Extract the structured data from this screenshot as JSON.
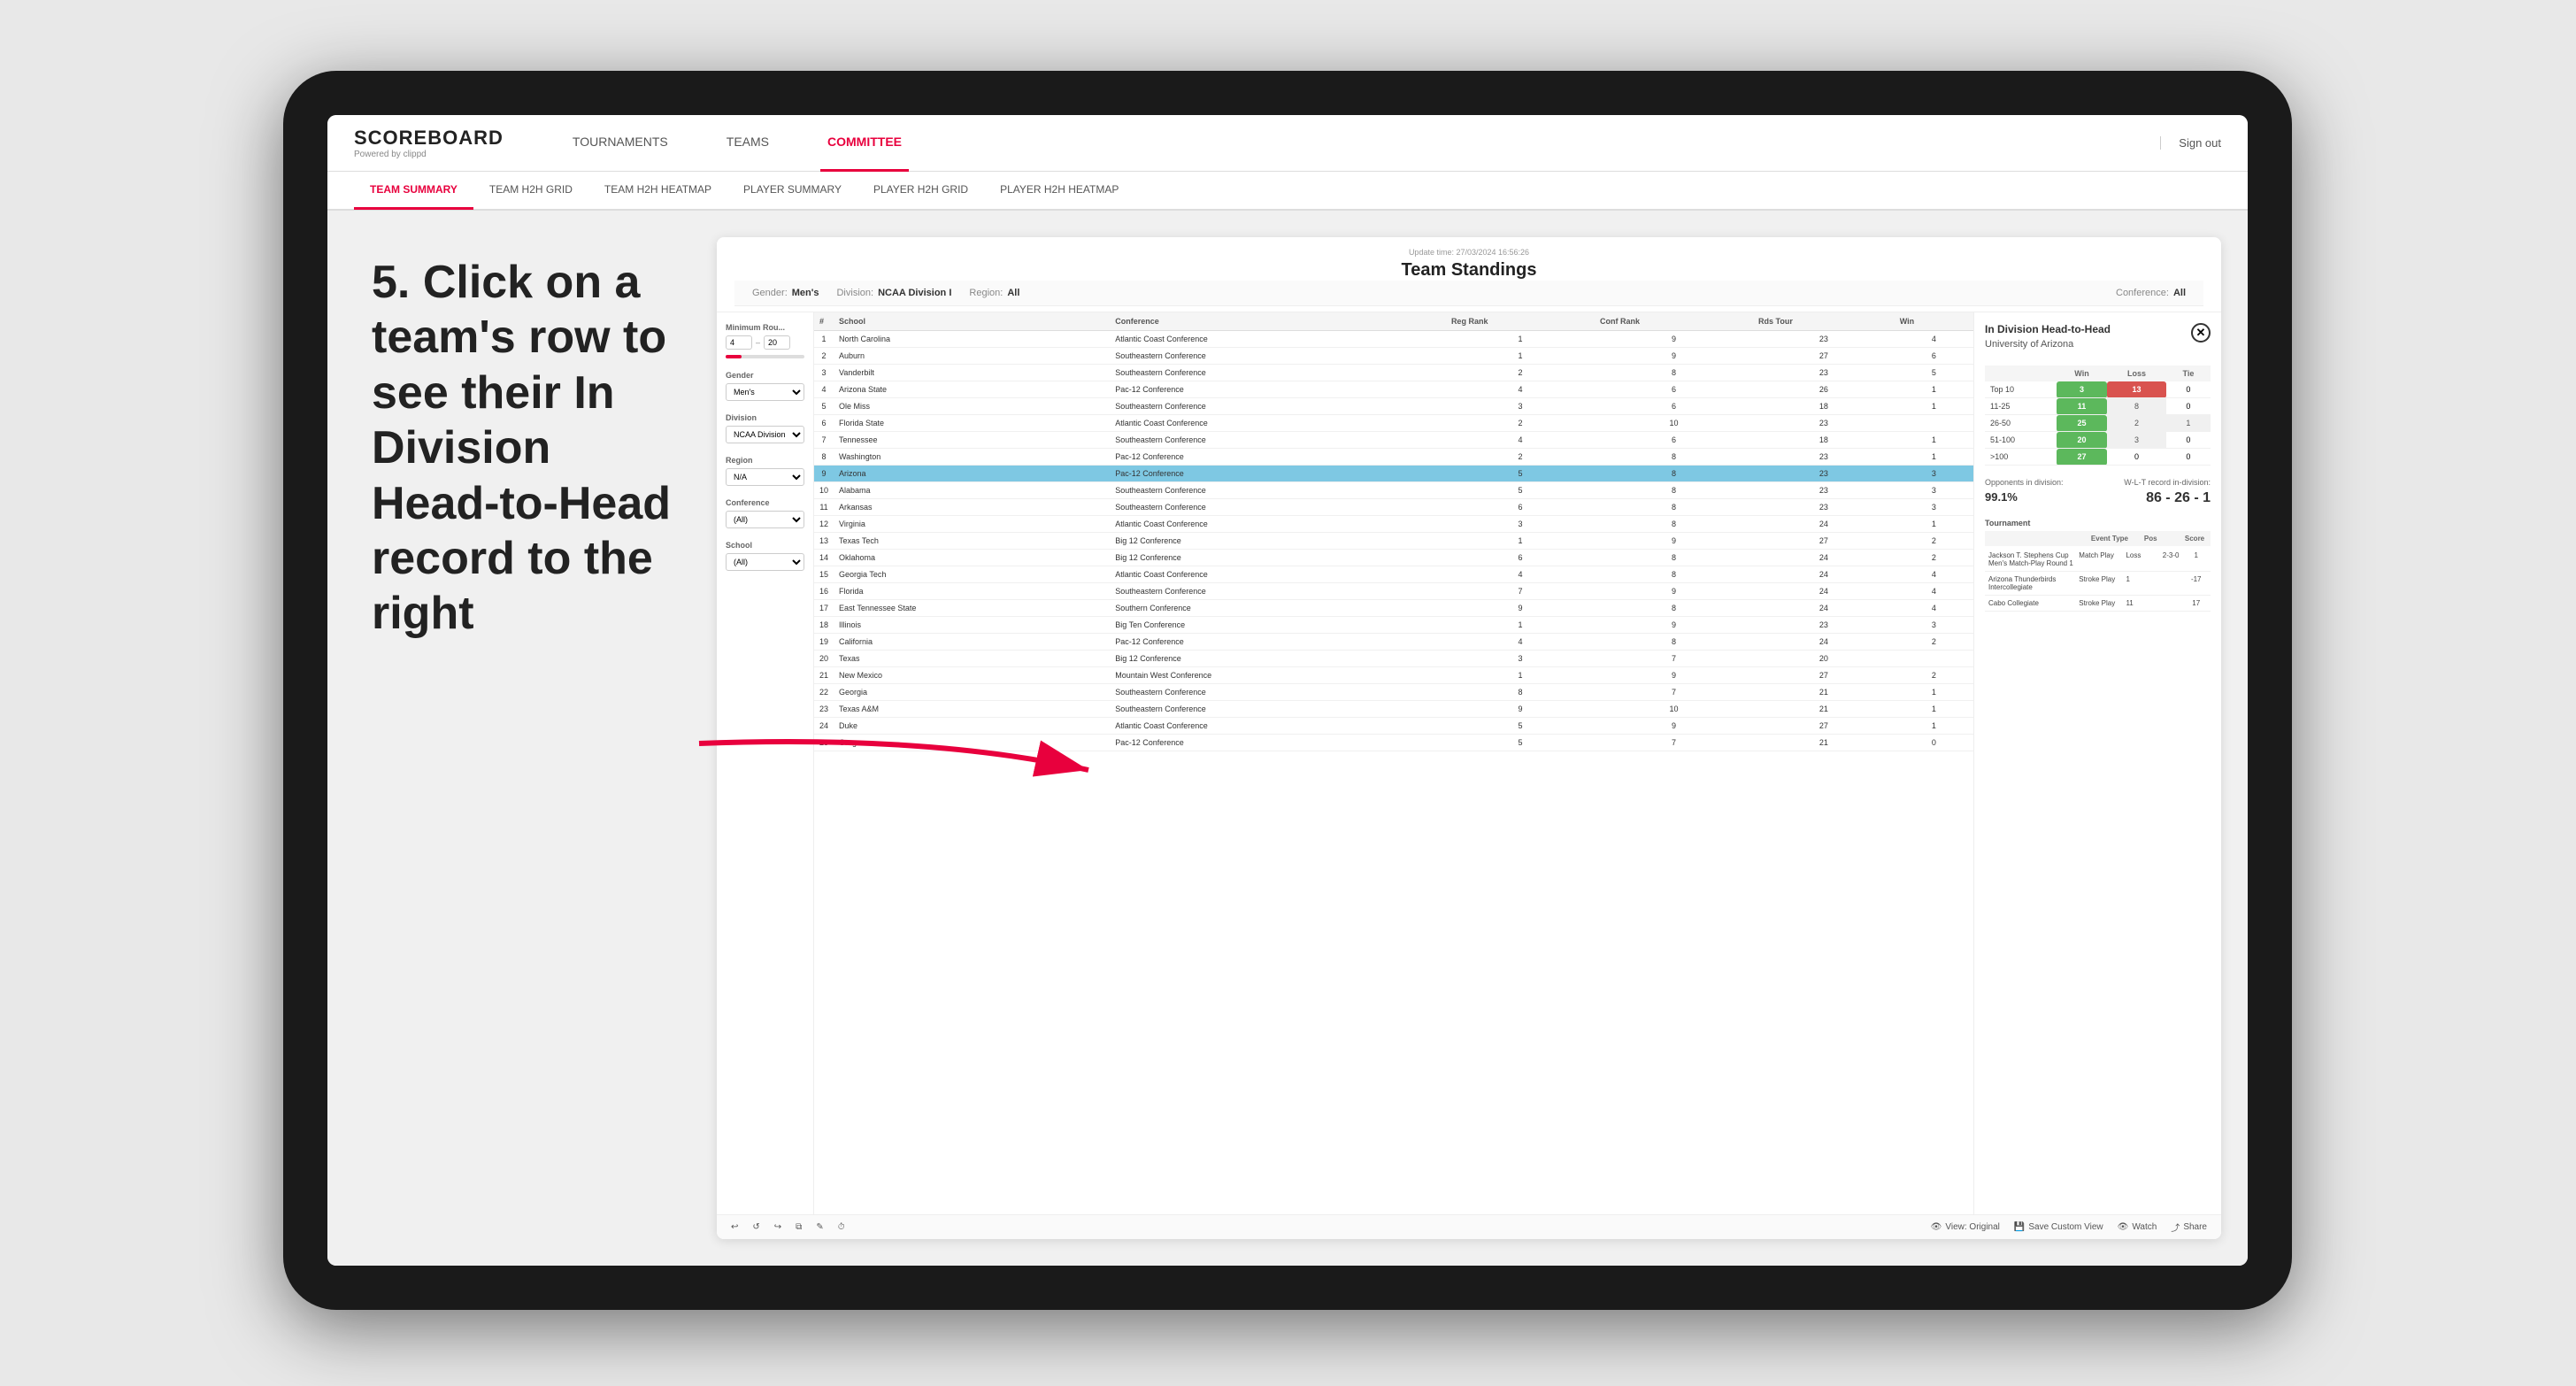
{
  "page": {
    "background": "#e8e8e8"
  },
  "nav": {
    "logo": "SCOREBOARD",
    "logo_sub": "Powered by clippd",
    "items": [
      {
        "label": "TOURNAMENTS",
        "active": false
      },
      {
        "label": "TEAMS",
        "active": false
      },
      {
        "label": "COMMITTEE",
        "active": true
      }
    ],
    "sign_out": "Sign out"
  },
  "sub_nav": {
    "items": [
      {
        "label": "TEAM SUMMARY",
        "active": true
      },
      {
        "label": "TEAM H2H GRID",
        "active": false
      },
      {
        "label": "TEAM H2H HEATMAP",
        "active": false
      },
      {
        "label": "PLAYER SUMMARY",
        "active": false
      },
      {
        "label": "PLAYER H2H GRID",
        "active": false
      },
      {
        "label": "PLAYER H2H HEATMAP",
        "active": false
      }
    ]
  },
  "instruction": {
    "text": "5. Click on a team's row to see their In Division Head-to-Head record to the right"
  },
  "app": {
    "update_time_label": "Update time:",
    "update_time": "27/03/2024 16:56:26",
    "title": "Team Standings",
    "filters": {
      "gender_label": "Gender:",
      "gender_value": "Men's",
      "division_label": "Division:",
      "division_value": "NCAA Division I",
      "region_label": "Region:",
      "region_value": "All",
      "conference_label": "Conference:",
      "conference_value": "All"
    },
    "sidebar": {
      "min_rounds_label": "Minimum Rou...",
      "min_val": "4",
      "max_val": "20",
      "gender_label": "Gender",
      "gender_options": [
        "Men's"
      ],
      "division_label": "Division",
      "division_options": [
        "NCAA Division I"
      ],
      "region_label": "Region",
      "region_options": [
        "N/A"
      ],
      "conference_label": "Conference",
      "conference_options": [
        "(All)"
      ],
      "school_label": "School",
      "school_options": [
        "(All)"
      ]
    },
    "table": {
      "headers": [
        "#",
        "School",
        "Conference",
        "Reg Rank",
        "Conf Rank",
        "Rds Tour",
        "Win"
      ],
      "rows": [
        {
          "rank": "1",
          "school": "North Carolina",
          "conference": "Atlantic Coast Conference",
          "reg_rank": "1",
          "conf_rank": "9",
          "rds": "23",
          "win": "4"
        },
        {
          "rank": "2",
          "school": "Auburn",
          "conference": "Southeastern Conference",
          "reg_rank": "1",
          "conf_rank": "9",
          "rds": "27",
          "win": "6"
        },
        {
          "rank": "3",
          "school": "Vanderbilt",
          "conference": "Southeastern Conference",
          "reg_rank": "2",
          "conf_rank": "8",
          "rds": "23",
          "win": "5"
        },
        {
          "rank": "4",
          "school": "Arizona State",
          "conference": "Pac-12 Conference",
          "reg_rank": "4",
          "conf_rank": "6",
          "rds": "26",
          "win": "1"
        },
        {
          "rank": "5",
          "school": "Ole Miss",
          "conference": "Southeastern Conference",
          "reg_rank": "3",
          "conf_rank": "6",
          "rds": "18",
          "win": "1"
        },
        {
          "rank": "6",
          "school": "Florida State",
          "conference": "Atlantic Coast Conference",
          "reg_rank": "2",
          "conf_rank": "10",
          "rds": "23",
          "win": ""
        },
        {
          "rank": "7",
          "school": "Tennessee",
          "conference": "Southeastern Conference",
          "reg_rank": "4",
          "conf_rank": "6",
          "rds": "18",
          "win": "1"
        },
        {
          "rank": "8",
          "school": "Washington",
          "conference": "Pac-12 Conference",
          "reg_rank": "2",
          "conf_rank": "8",
          "rds": "23",
          "win": "1"
        },
        {
          "rank": "9",
          "school": "Arizona",
          "conference": "Pac-12 Conference",
          "reg_rank": "5",
          "conf_rank": "8",
          "rds": "23",
          "win": "3",
          "selected": true
        },
        {
          "rank": "10",
          "school": "Alabama",
          "conference": "Southeastern Conference",
          "reg_rank": "5",
          "conf_rank": "8",
          "rds": "23",
          "win": "3"
        },
        {
          "rank": "11",
          "school": "Arkansas",
          "conference": "Southeastern Conference",
          "reg_rank": "6",
          "conf_rank": "8",
          "rds": "23",
          "win": "3"
        },
        {
          "rank": "12",
          "school": "Virginia",
          "conference": "Atlantic Coast Conference",
          "reg_rank": "3",
          "conf_rank": "8",
          "rds": "24",
          "win": "1"
        },
        {
          "rank": "13",
          "school": "Texas Tech",
          "conference": "Big 12 Conference",
          "reg_rank": "1",
          "conf_rank": "9",
          "rds": "27",
          "win": "2"
        },
        {
          "rank": "14",
          "school": "Oklahoma",
          "conference": "Big 12 Conference",
          "reg_rank": "6",
          "conf_rank": "8",
          "rds": "24",
          "win": "2"
        },
        {
          "rank": "15",
          "school": "Georgia Tech",
          "conference": "Atlantic Coast Conference",
          "reg_rank": "4",
          "conf_rank": "8",
          "rds": "24",
          "win": "4"
        },
        {
          "rank": "16",
          "school": "Florida",
          "conference": "Southeastern Conference",
          "reg_rank": "7",
          "conf_rank": "9",
          "rds": "24",
          "win": "4"
        },
        {
          "rank": "17",
          "school": "East Tennessee State",
          "conference": "Southern Conference",
          "reg_rank": "9",
          "conf_rank": "8",
          "rds": "24",
          "win": "4"
        },
        {
          "rank": "18",
          "school": "Illinois",
          "conference": "Big Ten Conference",
          "reg_rank": "1",
          "conf_rank": "9",
          "rds": "23",
          "win": "3"
        },
        {
          "rank": "19",
          "school": "California",
          "conference": "Pac-12 Conference",
          "reg_rank": "4",
          "conf_rank": "8",
          "rds": "24",
          "win": "2"
        },
        {
          "rank": "20",
          "school": "Texas",
          "conference": "Big 12 Conference",
          "reg_rank": "3",
          "conf_rank": "7",
          "rds": "20",
          "win": ""
        },
        {
          "rank": "21",
          "school": "New Mexico",
          "conference": "Mountain West Conference",
          "reg_rank": "1",
          "conf_rank": "9",
          "rds": "27",
          "win": "2"
        },
        {
          "rank": "22",
          "school": "Georgia",
          "conference": "Southeastern Conference",
          "reg_rank": "8",
          "conf_rank": "7",
          "rds": "21",
          "win": "1"
        },
        {
          "rank": "23",
          "school": "Texas A&M",
          "conference": "Southeastern Conference",
          "reg_rank": "9",
          "conf_rank": "10",
          "rds": "21",
          "win": "1"
        },
        {
          "rank": "24",
          "school": "Duke",
          "conference": "Atlantic Coast Conference",
          "reg_rank": "5",
          "conf_rank": "9",
          "rds": "27",
          "win": "1"
        },
        {
          "rank": "25",
          "school": "Oregon",
          "conference": "Pac-12 Conference",
          "reg_rank": "5",
          "conf_rank": "7",
          "rds": "21",
          "win": "0"
        }
      ]
    },
    "h2h": {
      "title": "In Division Head-to-Head",
      "team": "University of Arizona",
      "table_headers": [
        "",
        "Win",
        "Loss",
        "Tie"
      ],
      "rows": [
        {
          "label": "Top 10",
          "win": "3",
          "loss": "13",
          "tie": "0",
          "win_color": "green",
          "loss_color": "red"
        },
        {
          "label": "11-25",
          "win": "11",
          "loss": "8",
          "tie": "0",
          "win_color": "green",
          "loss_color": "light"
        },
        {
          "label": "26-50",
          "win": "25",
          "loss": "2",
          "tie": "1",
          "win_color": "green",
          "loss_color": "light"
        },
        {
          "label": "51-100",
          "win": "20",
          "loss": "3",
          "tie": "0",
          "win_color": "green",
          "loss_color": "light"
        },
        {
          "label": ">100",
          "win": "27",
          "loss": "0",
          "tie": "0",
          "win_color": "green",
          "loss_color": "light"
        }
      ],
      "opponents_label": "Opponents in division:",
      "opponents_value": "99.1%",
      "record_label": "W-L-T record in-division:",
      "record_value": "86 - 26 - 1",
      "tournaments": [
        {
          "name": "Jackson T. Stephens Cup Men's Match-Play Round 1",
          "type": "Match Play",
          "result": "Loss",
          "pos": "2-3-0",
          "score": "1"
        },
        {
          "name": "Arizona Thunderbirds Intercollegiate",
          "type": "Stroke Play",
          "result": "1",
          "pos": "",
          "score": "-17"
        },
        {
          "name": "Cabo Collegiate",
          "type": "Stroke Play",
          "result": "11",
          "pos": "",
          "score": "17"
        }
      ]
    },
    "footer": {
      "undo": "↩",
      "redo": "↪",
      "view_original": "View: Original",
      "save_custom": "Save Custom View",
      "watch": "Watch",
      "share": "Share"
    }
  }
}
